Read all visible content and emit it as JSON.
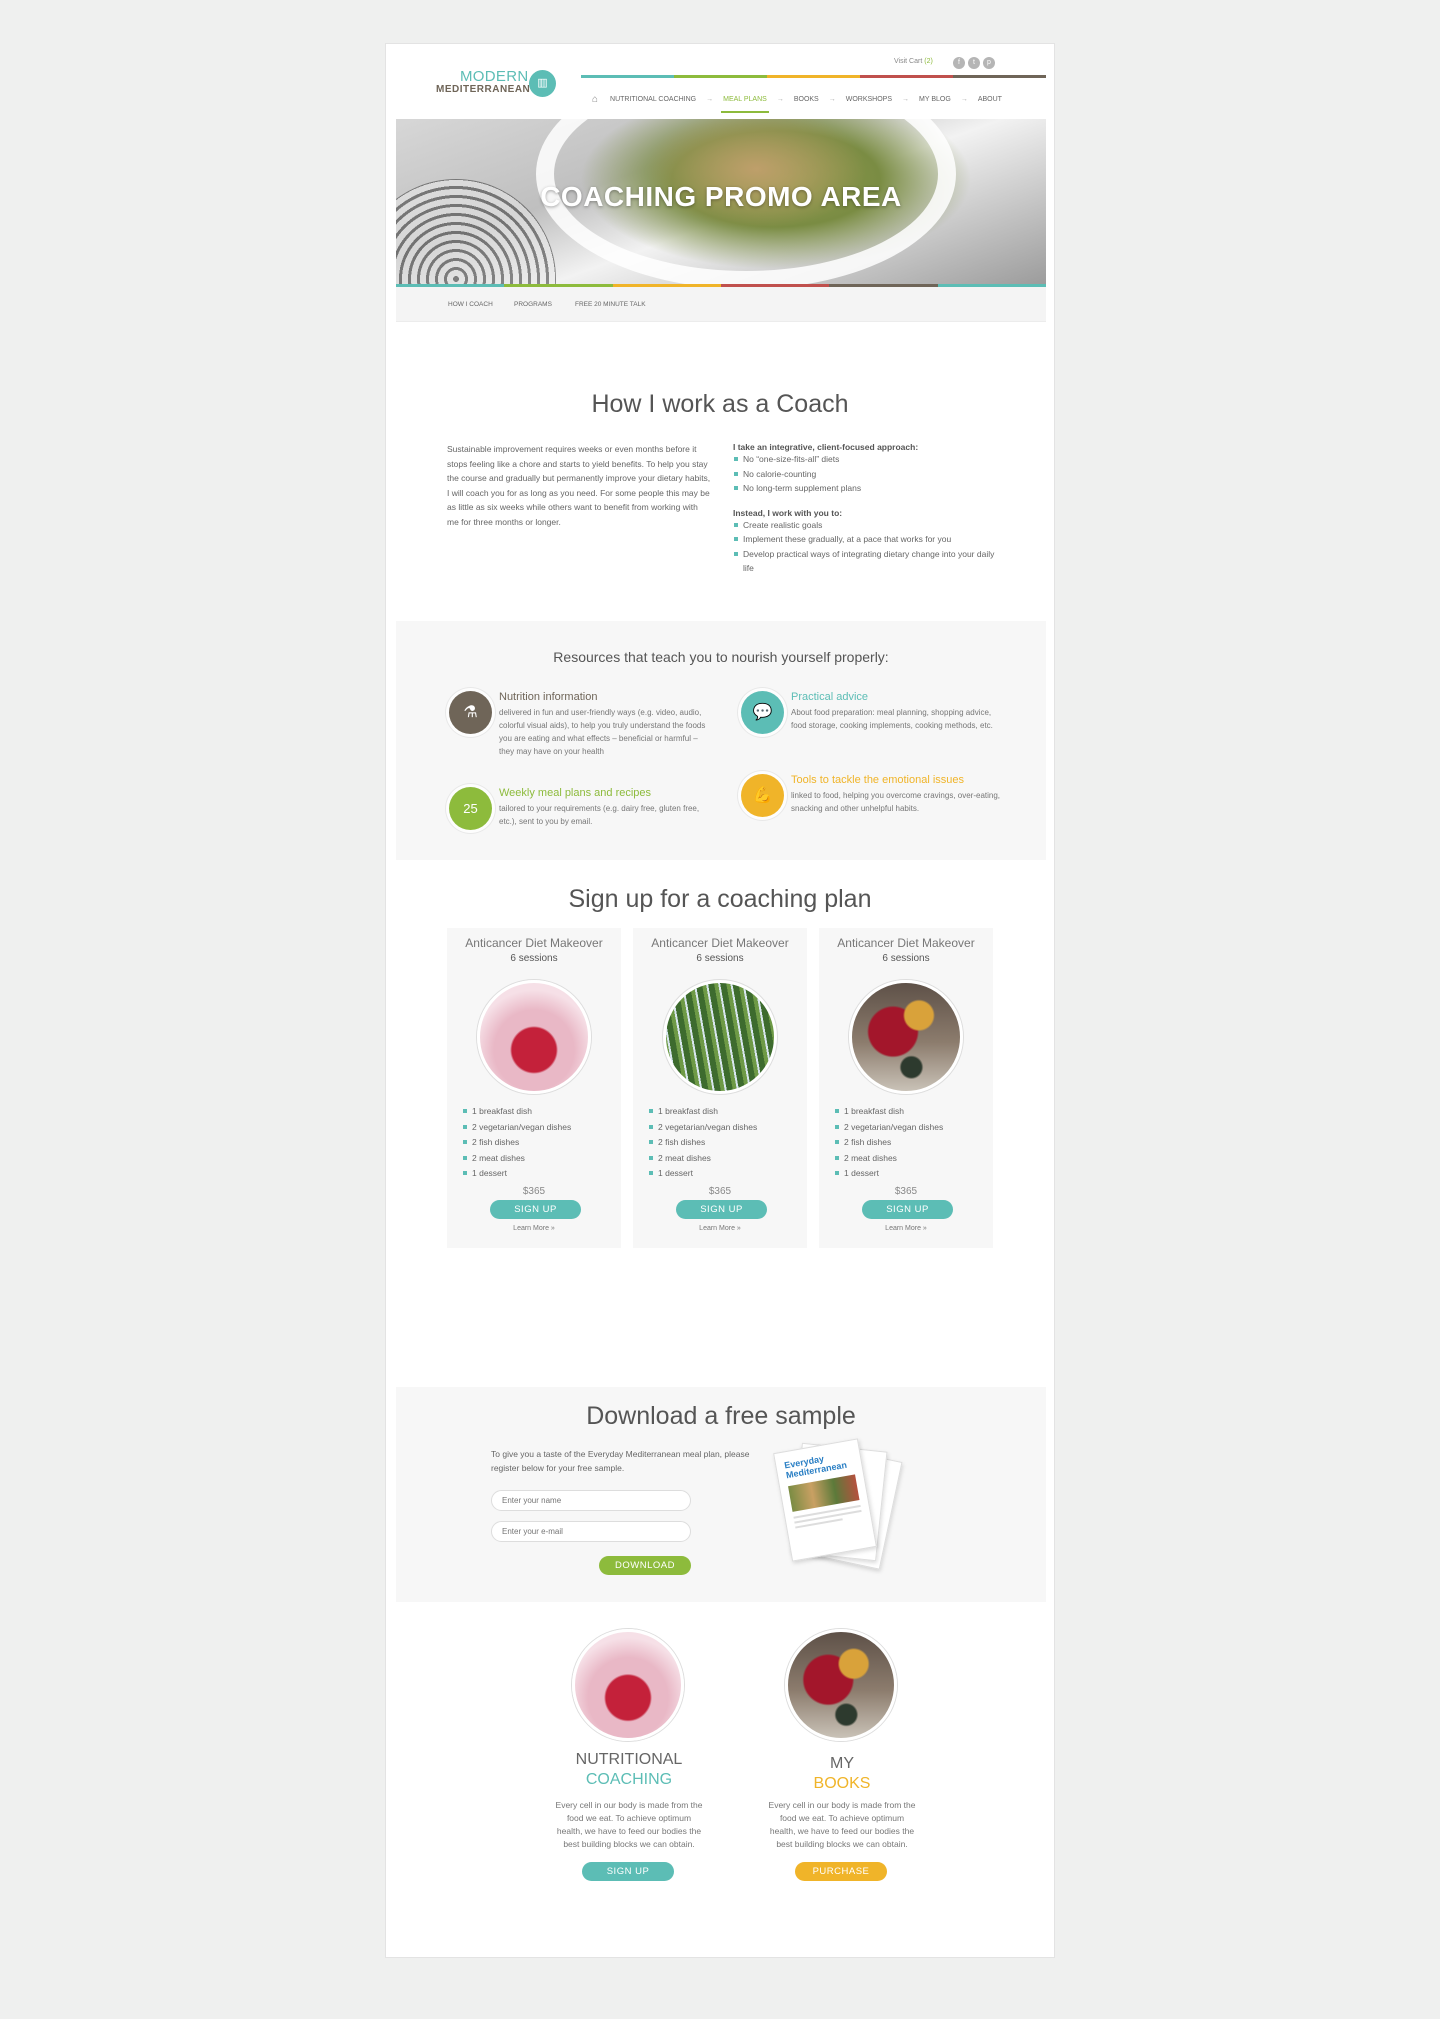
{
  "header": {
    "logo_line1": "MODERN",
    "logo_line2": "MEDITERRANEAN",
    "visit_cart_label": "Visit Cart",
    "cart_count": "(2)",
    "social": [
      "f",
      "t",
      "p"
    ],
    "nav": [
      "NUTRITIONAL COACHING",
      "MEAL PLANS",
      "BOOKS",
      "WORKSHOPS",
      "MY BLOG",
      "ABOUT"
    ],
    "nav_active_index": 1,
    "bar_colors": [
      "#5cbdb5",
      "#8dbb3c",
      "#f0b429",
      "#c0504d",
      "#6f6558"
    ]
  },
  "hero": {
    "title": "COACHING PROMO AREA",
    "subnav": [
      "HOW I COACH",
      "PROGRAMS",
      "FREE 20 MINUTE TALK"
    ]
  },
  "how": {
    "title": "How I work as a Coach",
    "left_text": "Sustainable improvement requires weeks or even months before it stops feeling like a chore and starts to yield benefits. To help you stay the course and gradually but permanently improve your dietary habits, I will coach you for as long as you need. For some people this may be as little as six weeks while others want to benefit from working with me for three months or longer.",
    "list1_title": "I take an integrative, client-focused approach:",
    "list1": [
      "No “one-size-fits-all” diets",
      "No calorie-counting",
      "No long-term supplement plans"
    ],
    "list2_title": "Instead, I work with you to:",
    "list2": [
      "Create realistic goals",
      "Implement these gradually, at a pace that works for you",
      "Develop practical ways of integrating dietary change into your daily life"
    ]
  },
  "resources": {
    "title": "Resources that teach you to nourish yourself properly:",
    "items": [
      {
        "title": "Nutrition information",
        "desc": "delivered in fun and user-friendly ways (e.g. video, audio, colorful visual aids), to help you truly understand the foods you are eating and what effects – beneficial or harmful – they may have on your health",
        "color": "#6f6558",
        "icon": "mortar-icon",
        "glyph": "⚗"
      },
      {
        "title": "Practical advice",
        "desc": "About food preparation: meal planning, shopping advice, food storage, cooking implements, cooking methods, etc.",
        "color": "#5cbdb5",
        "icon": "speech-bubbles-icon",
        "glyph": "💬"
      },
      {
        "title": "Weekly meal plans and recipes",
        "desc": "tailored to your requirements (e.g. dairy free, gluten free, etc.), sent to you by email.",
        "color": "#8dbb3c",
        "icon": "calendar-icon",
        "glyph": "25"
      },
      {
        "title": "Tools to tackle the emotional issues",
        "desc": "linked to food, helping you overcome cravings, over-eating, snacking and other unhelpful habits.",
        "color": "#f0b429",
        "icon": "muscle-arm-icon",
        "glyph": "💪"
      }
    ]
  },
  "plans": {
    "title": "Sign up for a coaching plan",
    "cards": [
      {
        "title": "Anticancer Diet Makeover",
        "sessions": "6 sessions",
        "image": "raspberries",
        "items": [
          "1 breakfast dish",
          "2 vegetarian/vegan dishes",
          "2 fish dishes",
          "2 meat dishes",
          "1 dessert"
        ],
        "price": "$365",
        "button": "SIGN UP",
        "learn": "Learn More »"
      },
      {
        "title": "Anticancer Diet Makeover",
        "sessions": "6 sessions",
        "image": "asparagus",
        "items": [
          "1 breakfast dish",
          "2 vegetarian/vegan dishes",
          "2 fish dishes",
          "2 meat dishes",
          "1 dessert"
        ],
        "price": "$365",
        "button": "SIGN UP",
        "learn": "Learn More »"
      },
      {
        "title": "Anticancer Diet Makeover",
        "sessions": "6 sessions",
        "image": "pomegranate",
        "items": [
          "1 breakfast dish",
          "2 vegetarian/vegan dishes",
          "2 fish dishes",
          "2 meat dishes",
          "1 dessert"
        ],
        "price": "$365",
        "button": "SIGN UP",
        "learn": "Learn More »"
      }
    ]
  },
  "download": {
    "title": "Download a free sample",
    "text": "To give you a taste of the Everyday Mediterranean meal plan, please register below for your free sample.",
    "name_placeholder": "Enter your name",
    "email_placeholder": "Enter your e-mail",
    "button": "DOWNLOAD",
    "booklet_title": "Everyday Mediterranean"
  },
  "features": [
    {
      "line1": "NUTRITIONAL",
      "line2": "COACHING",
      "color": "#5cbdb5",
      "desc": "Every cell in our body is made from the food we eat. To achieve optimum health, we have to feed our bodies the best building blocks we can obtain.",
      "button": "SIGN UP",
      "image": "raspberries"
    },
    {
      "line1": "MY",
      "line2": "BOOKS",
      "color": "#f0b429",
      "desc": "Every cell in our body is made from the food we eat. To achieve optimum health, we have to feed our bodies the best building blocks we can obtain.",
      "button": "PURCHASE",
      "image": "pomegranate"
    }
  ]
}
